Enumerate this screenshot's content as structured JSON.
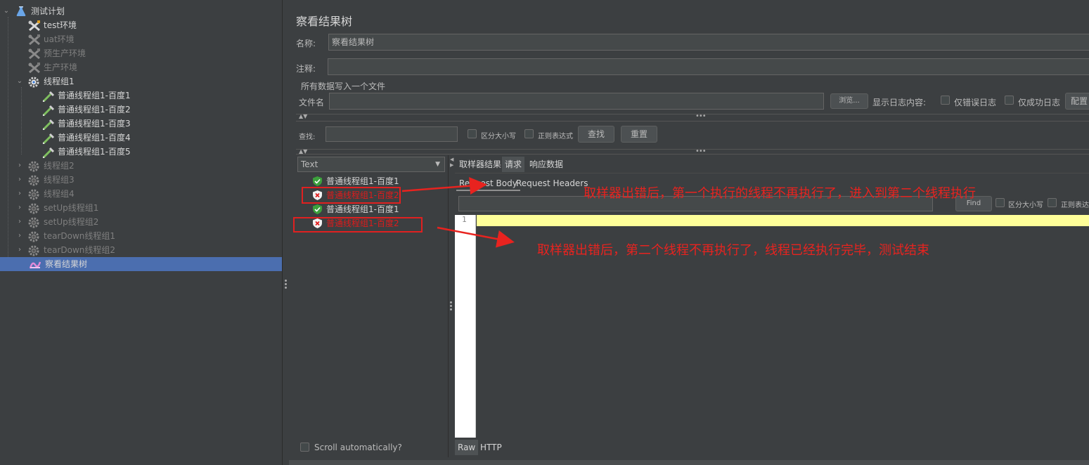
{
  "tree": {
    "items": [
      {
        "label": "测试计划",
        "icon": "flask-icon",
        "arrow": "expanded"
      },
      {
        "label": "test环境",
        "icon": "tools-icon"
      },
      {
        "label": "uat环境",
        "icon": "tools-icon",
        "disabled": true
      },
      {
        "label": "预生产环境",
        "icon": "tools-icon",
        "disabled": true
      },
      {
        "label": "生产环境",
        "icon": "tools-icon",
        "disabled": true
      },
      {
        "label": "线程组1",
        "icon": "gear-icon",
        "arrow": "expanded"
      },
      {
        "label": "普通线程组1-百度1",
        "icon": "pipette-icon"
      },
      {
        "label": "普通线程组1-百度2",
        "icon": "pipette-icon"
      },
      {
        "label": "普通线程组1-百度3",
        "icon": "pipette-icon"
      },
      {
        "label": "普通线程组1-百度4",
        "icon": "pipette-icon"
      },
      {
        "label": "普通线程组1-百度5",
        "icon": "pipette-icon"
      },
      {
        "label": "线程组2",
        "icon": "gear-icon",
        "arrow": "collapsed",
        "disabled": true
      },
      {
        "label": "线程组3",
        "icon": "gear-icon",
        "arrow": "collapsed",
        "disabled": true
      },
      {
        "label": "线程组4",
        "icon": "gear-icon",
        "arrow": "collapsed",
        "disabled": true
      },
      {
        "label": "setUp线程组1",
        "icon": "gear-icon",
        "arrow": "collapsed",
        "disabled": true
      },
      {
        "label": "setUp线程组2",
        "icon": "gear-icon",
        "arrow": "collapsed",
        "disabled": true
      },
      {
        "label": "tearDown线程组1",
        "icon": "gear-icon",
        "arrow": "collapsed",
        "disabled": true
      },
      {
        "label": "tearDown线程组2",
        "icon": "gear-icon",
        "arrow": "collapsed",
        "disabled": true
      },
      {
        "label": "察看结果树",
        "icon": "graph-icon",
        "selected": true
      }
    ]
  },
  "panel": {
    "title": "察看结果树",
    "name_label": "名称:",
    "name_value": "察看结果树",
    "comment_label": "注释:",
    "comment_value": "",
    "file_group_label": "所有数据写入一个文件",
    "file_label": "文件名",
    "file_value": "",
    "browse_label": "浏览...",
    "log_content_label": "显示日志内容:",
    "errors_only_label": "仅错误日志",
    "success_only_label": "仅成功日志",
    "config_label": "配置",
    "search_label": "查找:",
    "search_value": "",
    "case_sensitive_label": "区分大小写",
    "regex_label": "正则表达式",
    "find_button": "查找",
    "reset_button": "重置"
  },
  "results": {
    "renderer": "Text",
    "items": [
      {
        "label": "普通线程组1-百度1",
        "status": "ok"
      },
      {
        "label": "普通线程组1-百度2",
        "status": "error"
      },
      {
        "label": "普通线程组1-百度1",
        "status": "ok"
      },
      {
        "label": "普通线程组1-百度2",
        "status": "error"
      }
    ],
    "scroll_auto_label": "Scroll automatically?"
  },
  "detail": {
    "tabs": [
      "取样器结果",
      "请求",
      "响应数据"
    ],
    "active_tab": "请求",
    "subtabs": [
      "Request Body",
      "Request Headers"
    ],
    "find_button": "Find",
    "case_sensitive_label": "区分大小写",
    "regex_label": "正则表达式",
    "line_number": "1",
    "bottom_tabs": [
      "Raw",
      "HTTP"
    ]
  },
  "annotations": {
    "note1": "取样器出错后，第一个执行的线程不再执行了，进入到第二个线程执行",
    "note2": "取样器出错后，第二个线程不再执行了，线程已经执行完毕，测试结束"
  },
  "colors": {
    "background": "#3c3f41",
    "selection": "#4b6eaf",
    "error_text": "#e01b1b",
    "annotation": "#e8231f",
    "editor_highlight": "#ffff99"
  }
}
